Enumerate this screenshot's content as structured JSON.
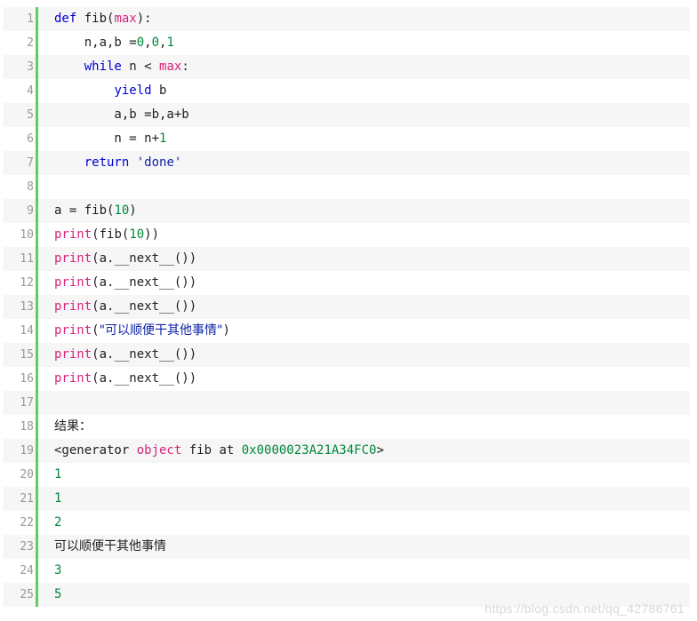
{
  "lines": [
    {
      "num": "1",
      "parts": [
        {
          "t": "kw",
          "v": "def"
        },
        {
          "t": "",
          "v": " fib("
        },
        {
          "t": "bi",
          "v": "max"
        },
        {
          "t": "",
          "v": "):"
        }
      ]
    },
    {
      "num": "2",
      "parts": [
        {
          "t": "",
          "v": "    n,a,b ="
        },
        {
          "t": "num",
          "v": "0"
        },
        {
          "t": "",
          "v": ","
        },
        {
          "t": "num",
          "v": "0"
        },
        {
          "t": "",
          "v": ","
        },
        {
          "t": "num",
          "v": "1"
        }
      ]
    },
    {
      "num": "3",
      "parts": [
        {
          "t": "",
          "v": "    "
        },
        {
          "t": "kw",
          "v": "while"
        },
        {
          "t": "",
          "v": " n < "
        },
        {
          "t": "bi",
          "v": "max"
        },
        {
          "t": "",
          "v": ":"
        }
      ]
    },
    {
      "num": "4",
      "parts": [
        {
          "t": "",
          "v": "        "
        },
        {
          "t": "kw",
          "v": "yield"
        },
        {
          "t": "",
          "v": " b"
        }
      ]
    },
    {
      "num": "5",
      "parts": [
        {
          "t": "",
          "v": "        a,b =b,a+b"
        }
      ]
    },
    {
      "num": "6",
      "parts": [
        {
          "t": "",
          "v": "        n = n+"
        },
        {
          "t": "num",
          "v": "1"
        }
      ]
    },
    {
      "num": "7",
      "parts": [
        {
          "t": "",
          "v": "    "
        },
        {
          "t": "kw",
          "v": "return"
        },
        {
          "t": "",
          "v": " "
        },
        {
          "t": "str",
          "v": "'done'"
        }
      ]
    },
    {
      "num": "8",
      "parts": []
    },
    {
      "num": "9",
      "parts": [
        {
          "t": "",
          "v": "a = fib("
        },
        {
          "t": "num",
          "v": "10"
        },
        {
          "t": "",
          "v": ")"
        }
      ]
    },
    {
      "num": "10",
      "parts": [
        {
          "t": "bi",
          "v": "print"
        },
        {
          "t": "",
          "v": "(fib("
        },
        {
          "t": "num",
          "v": "10"
        },
        {
          "t": "",
          "v": "))"
        }
      ]
    },
    {
      "num": "11",
      "parts": [
        {
          "t": "bi",
          "v": "print"
        },
        {
          "t": "",
          "v": "(a.__next__())"
        }
      ]
    },
    {
      "num": "12",
      "parts": [
        {
          "t": "bi",
          "v": "print"
        },
        {
          "t": "",
          "v": "(a.__next__())"
        }
      ]
    },
    {
      "num": "13",
      "parts": [
        {
          "t": "bi",
          "v": "print"
        },
        {
          "t": "",
          "v": "(a.__next__())"
        }
      ]
    },
    {
      "num": "14",
      "parts": [
        {
          "t": "bi",
          "v": "print"
        },
        {
          "t": "",
          "v": "("
        },
        {
          "t": "str cjk",
          "v": "\"可以顺便干其他事情\""
        },
        {
          "t": "",
          "v": ")"
        }
      ]
    },
    {
      "num": "15",
      "parts": [
        {
          "t": "bi",
          "v": "print"
        },
        {
          "t": "",
          "v": "(a.__next__())"
        }
      ]
    },
    {
      "num": "16",
      "parts": [
        {
          "t": "bi",
          "v": "print"
        },
        {
          "t": "",
          "v": "(a.__next__())"
        }
      ]
    },
    {
      "num": "17",
      "parts": []
    },
    {
      "num": "18",
      "parts": [
        {
          "t": "cjk",
          "v": "结果："
        }
      ]
    },
    {
      "num": "19",
      "parts": [
        {
          "t": "",
          "v": "<generator "
        },
        {
          "t": "bi",
          "v": "object"
        },
        {
          "t": "",
          "v": " fib at "
        },
        {
          "t": "num",
          "v": "0x0000023A21A34FC0"
        },
        {
          "t": "",
          "v": ">"
        }
      ]
    },
    {
      "num": "20",
      "parts": [
        {
          "t": "num",
          "v": "1"
        }
      ]
    },
    {
      "num": "21",
      "parts": [
        {
          "t": "num",
          "v": "1"
        }
      ]
    },
    {
      "num": "22",
      "parts": [
        {
          "t": "num",
          "v": "2"
        }
      ]
    },
    {
      "num": "23",
      "parts": [
        {
          "t": "cjk",
          "v": "可以顺便干其他事情"
        }
      ]
    },
    {
      "num": "24",
      "parts": [
        {
          "t": "num",
          "v": "3"
        }
      ]
    },
    {
      "num": "25",
      "parts": [
        {
          "t": "num",
          "v": "5"
        }
      ]
    }
  ],
  "watermark": "https://blog.csdn.net/qq_42786761",
  "colors": {
    "keyword": "#0000d6",
    "builtin": "#d6247a",
    "number": "#00873c",
    "string": "#0f24a8",
    "gutter_border": "#5fcf5f",
    "odd_row_bg": "#f6f6f6"
  }
}
